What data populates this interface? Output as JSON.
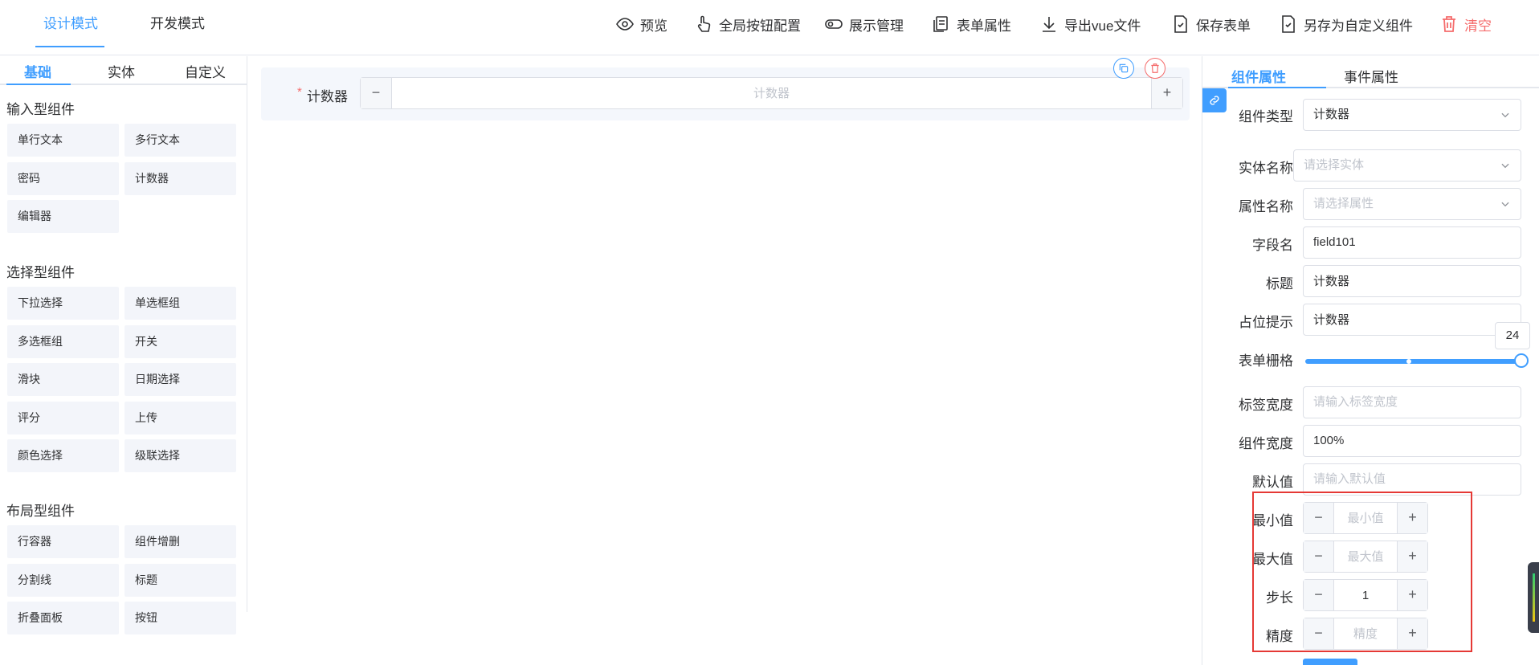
{
  "header": {
    "mode_tabs": [
      "设计模式",
      "开发模式"
    ],
    "actions": {
      "preview": "预览",
      "global_buttons": "全局按钮配置",
      "display_manage": "展示管理",
      "form_props": "表单属性",
      "export_vue": "导出vue文件",
      "save_form": "保存表单",
      "save_as_custom": "另存为自定义组件",
      "clear": "清空"
    }
  },
  "left_panel": {
    "tabs": [
      "基础",
      "实体",
      "自定义"
    ],
    "groups": [
      {
        "title": "输入型组件",
        "items": [
          "单行文本",
          "多行文本",
          "密码",
          "计数器",
          "编辑器"
        ]
      },
      {
        "title": "选择型组件",
        "items": [
          "下拉选择",
          "单选框组",
          "多选框组",
          "开关",
          "滑块",
          "日期选择",
          "评分",
          "上传",
          "颜色选择",
          "级联选择"
        ]
      },
      {
        "title": "布局型组件",
        "items": [
          "行容器",
          "组件增删",
          "分割线",
          "标题",
          "折叠面板",
          "按钮"
        ]
      }
    ]
  },
  "canvas": {
    "field": {
      "required_mark": "*",
      "label": "计数器",
      "placeholder": "计数器",
      "minus": "−",
      "plus": "+"
    }
  },
  "right_panel": {
    "tabs": [
      "组件属性",
      "事件属性"
    ],
    "props": {
      "component_type": {
        "label": "组件类型",
        "value": "计数器"
      },
      "entity_name": {
        "label": "实体名称",
        "placeholder": "请选择实体"
      },
      "attr_name": {
        "label": "属性名称",
        "placeholder": "请选择属性"
      },
      "field_name": {
        "label": "字段名",
        "value": "field101"
      },
      "title": {
        "label": "标题",
        "value": "计数器"
      },
      "placeholder": {
        "label": "占位提示",
        "value": "计数器"
      },
      "grid": {
        "label": "表单栅格",
        "value": "24"
      },
      "label_width": {
        "label": "标签宽度",
        "placeholder": "请输入标签宽度"
      },
      "comp_width": {
        "label": "组件宽度",
        "value": "100%"
      },
      "default_value": {
        "label": "默认值",
        "placeholder": "请输入默认值"
      },
      "min": {
        "label": "最小值",
        "placeholder": "最小值"
      },
      "max": {
        "label": "最大值",
        "placeholder": "最大值"
      },
      "step": {
        "label": "步长",
        "value": "1"
      },
      "precision": {
        "label": "精度",
        "placeholder": "精度"
      }
    }
  },
  "colors": {
    "primary": "#409eff",
    "danger": "#f56c6c",
    "highlight": "#e53935"
  }
}
